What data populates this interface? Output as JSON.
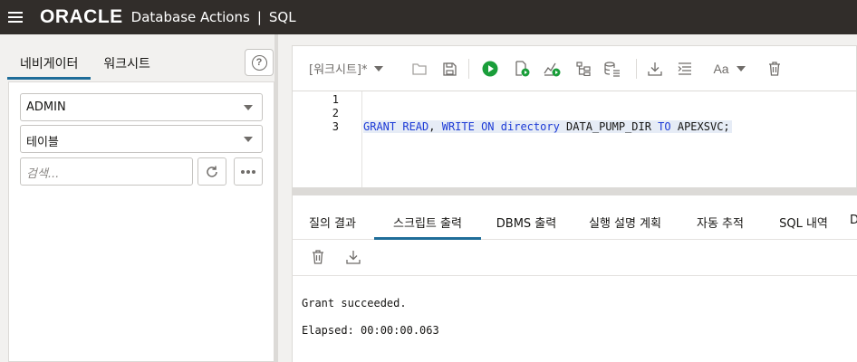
{
  "header": {
    "logo": "ORACLE",
    "product": "Database Actions",
    "separator": "|",
    "section": "SQL"
  },
  "navigator": {
    "tabs": [
      {
        "label": "네비게이터",
        "active": true
      },
      {
        "label": "워크시트",
        "active": false
      }
    ],
    "schema_select": "ADMIN",
    "object_type_select": "테이블",
    "search_placeholder": "검색...",
    "help_icon": "?"
  },
  "worksheet": {
    "name": "[워크시트]*",
    "toolbar_icons": [
      "folder-icon",
      "save-icon",
      "run-statement-icon",
      "run-script-icon",
      "explain-plan-icon",
      "autotrace-icon",
      "sql-tuning-icon",
      "download-icon",
      "format-icon",
      "font-icon",
      "trash-icon"
    ],
    "font_label": "Aa"
  },
  "editor": {
    "line_numbers": [
      "1",
      "2",
      "3"
    ],
    "code_tokens": [
      {
        "text": "GRANT",
        "kw": true
      },
      {
        "text": " ",
        "kw": false
      },
      {
        "text": "READ",
        "kw": true
      },
      {
        "text": ", ",
        "kw": false
      },
      {
        "text": "WRITE",
        "kw": true
      },
      {
        "text": " ",
        "kw": false
      },
      {
        "text": "ON",
        "kw": true
      },
      {
        "text": " ",
        "kw": false
      },
      {
        "text": "directory",
        "kw": true
      },
      {
        "text": " DATA_PUMP_DIR ",
        "kw": false
      },
      {
        "text": "TO",
        "kw": true
      },
      {
        "text": " APEXSVC;",
        "kw": false
      }
    ]
  },
  "output": {
    "tabs": [
      {
        "label": "질의 결과",
        "active": false
      },
      {
        "label": "스크립트 출력",
        "active": true
      },
      {
        "label": "DBMS 출력",
        "active": false
      },
      {
        "label": "실행 설명 계획",
        "active": false
      },
      {
        "label": "자동 추적",
        "active": false
      },
      {
        "label": "SQL 내역",
        "active": false
      },
      {
        "label": "D",
        "active": false
      }
    ],
    "lines": [
      "Grant succeeded.",
      "Elapsed: 00:00:00.063"
    ]
  },
  "colors": {
    "header_bg": "#312d2a",
    "accent": "#1f6d99",
    "run_green": "#1a9e3a",
    "keyword_blue": "#1d3bd6"
  }
}
